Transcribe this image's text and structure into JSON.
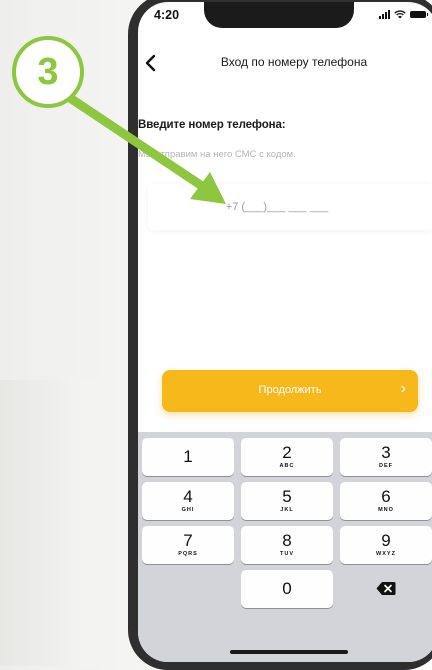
{
  "status_bar": {
    "time": "4:20"
  },
  "header": {
    "title": "Вход по номеру телефона",
    "back_icon": "chevron-left-icon"
  },
  "form": {
    "title": "Введите номер телефона:",
    "subtitle": "Мы отправим на него СМС с кодом.",
    "phone_placeholder": "+7 (___)___ ___ ___"
  },
  "continue_button": {
    "label": "Продолжить",
    "arrow": "›"
  },
  "keypad": {
    "keys": [
      {
        "digit": "1",
        "letters": ""
      },
      {
        "digit": "2",
        "letters": "ABC"
      },
      {
        "digit": "3",
        "letters": "DEF"
      },
      {
        "digit": "4",
        "letters": "GHI"
      },
      {
        "digit": "5",
        "letters": "JKL"
      },
      {
        "digit": "6",
        "letters": "MNO"
      },
      {
        "digit": "7",
        "letters": "PQRS"
      },
      {
        "digit": "8",
        "letters": "TUV"
      },
      {
        "digit": "9",
        "letters": "WXYZ"
      },
      {
        "digit": "0",
        "letters": ""
      }
    ],
    "delete_icon": "backspace-icon"
  },
  "annotation": {
    "step_number": "3",
    "accent_color": "#8dc63f"
  },
  "colors": {
    "button": "#f7b81c",
    "keyboard_bg": "#d2d4d9"
  }
}
